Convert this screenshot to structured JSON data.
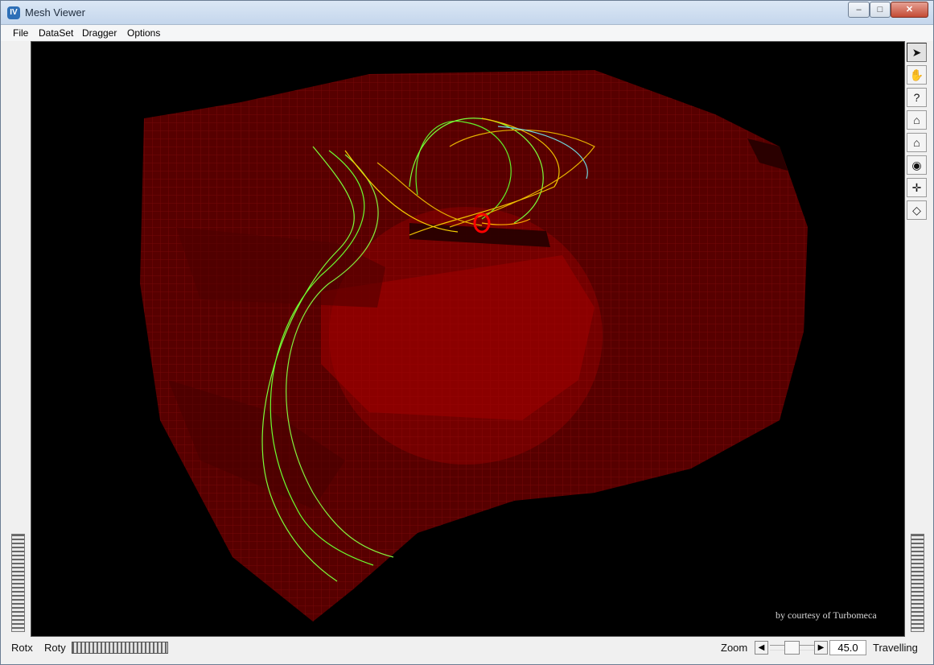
{
  "window": {
    "title": "Mesh Viewer",
    "controls": [
      "–",
      "□",
      "✕"
    ]
  },
  "menu": [
    "File",
    "DataSet",
    "Dragger",
    "Options"
  ],
  "viewer": {
    "courtesy_text": "by courtesy of Turbomeca",
    "background": "#000000",
    "mesh_color": "#7f0000",
    "stream_colors": [
      "#7cff3a",
      "#e5b000",
      "#ff0000",
      "#6fd6dc"
    ]
  },
  "toolbar": {
    "icons": [
      "select-arrow-icon",
      "hand-icon",
      "help-icon",
      "home-icon",
      "set-home-icon",
      "view-all-icon",
      "seek-icon",
      "camera-projection-icon"
    ]
  },
  "bottom": {
    "rotx": "Rotx",
    "roty": "Roty",
    "zoom": "Zoom",
    "zoom_value": "45.0",
    "travelling": "Travelling"
  }
}
